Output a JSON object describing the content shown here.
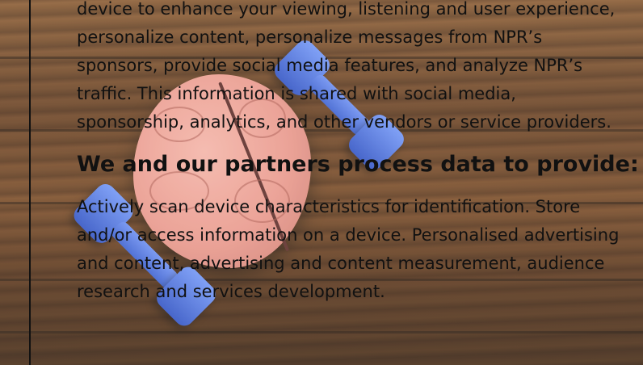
{
  "consent": {
    "intro_lines": [
      "device to enhance your viewing, listening and user experience,",
      "personalize content, personalize messages from NPR’s",
      "sponsors, provide social media features, and analyze NPR’s",
      "traffic. This information is shared with social media,",
      "sponsorship, analytics, and other vendors or service providers."
    ],
    "heading": "We and our partners process data to provide:",
    "purposes_lines": [
      "Actively scan device characteristics for identification. Store",
      "and/or access information on a device. Personalised advertising",
      "and content, advertising and content measurement, audience",
      "research and services development."
    ]
  },
  "colors": {
    "text": "#111111",
    "wood": "#6a4020",
    "dumbbell": "#3a5fd0",
    "brain": "#e9978a"
  }
}
